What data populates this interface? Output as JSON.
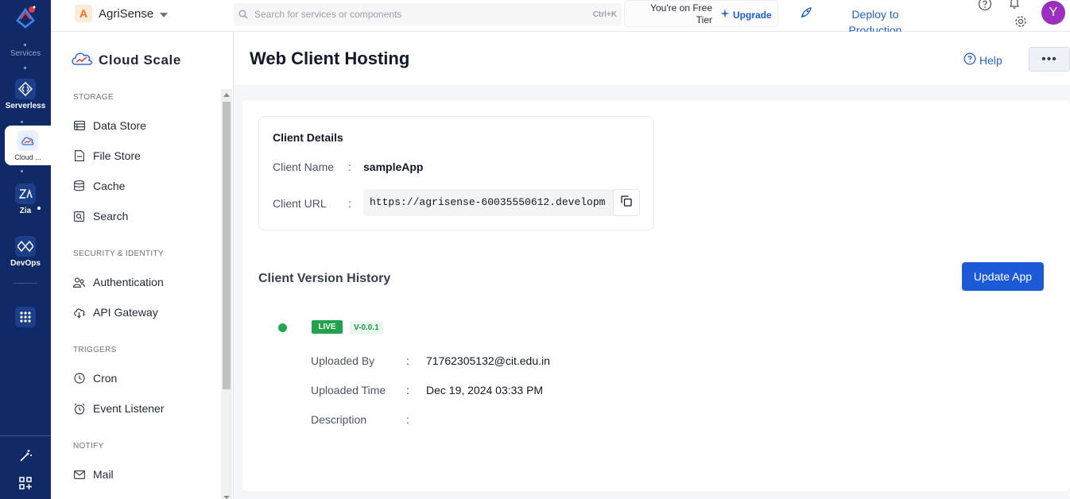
{
  "rail": {
    "services_label": "Services",
    "items": [
      {
        "label": "Serverless"
      },
      {
        "label": "Cloud ..."
      },
      {
        "label": "Zia"
      },
      {
        "label": "DevOps"
      }
    ]
  },
  "topbar": {
    "project_initial": "A",
    "project_name": "AgriSense",
    "search_placeholder": "Search for services or components",
    "search_shortcut": "Ctrl+K",
    "tier_line1": "You're on Free",
    "tier_line2": "Tier",
    "upgrade_label": "Upgrade",
    "deploy_line1": "Deploy to",
    "deploy_line2": "Production",
    "avatar_initial": "Y"
  },
  "sidebar": {
    "title": "Cloud Scale",
    "sections": [
      {
        "label": "STORAGE",
        "items": [
          {
            "label": "Data Store",
            "icon": "table-icon"
          },
          {
            "label": "File Store",
            "icon": "file-icon"
          },
          {
            "label": "Cache",
            "icon": "database-icon"
          },
          {
            "label": "Search",
            "icon": "search-icon"
          }
        ]
      },
      {
        "label": "SECURITY & IDENTITY",
        "items": [
          {
            "label": "Authentication",
            "icon": "users-icon"
          },
          {
            "label": "API Gateway",
            "icon": "cloud-gateway-icon"
          }
        ]
      },
      {
        "label": "TRIGGERS",
        "items": [
          {
            "label": "Cron",
            "icon": "clock-icon"
          },
          {
            "label": "Event Listener",
            "icon": "alarm-icon"
          }
        ]
      },
      {
        "label": "NOTIFY",
        "items": [
          {
            "label": "Mail",
            "icon": "mail-icon"
          }
        ]
      }
    ]
  },
  "main": {
    "title": "Web Client Hosting",
    "help_label": "Help",
    "more_label": "•••",
    "details": {
      "heading": "Client Details",
      "name_label": "Client Name",
      "name_value": "sampleApp",
      "url_label": "Client URL",
      "url_value": "https://agrisense-60035550612.developm",
      "colon": ":"
    },
    "history": {
      "title": "Client Version History",
      "update_label": "Update App",
      "status": "LIVE",
      "version": "V-0.0.1",
      "uploaded_by_label": "Uploaded By",
      "uploaded_by_value": "71762305132@cit.edu.in",
      "uploaded_time_label": "Uploaded Time",
      "uploaded_time_value": "Dec 19, 2024 03:33 PM",
      "description_label": "Description",
      "description_value": "",
      "colon": ":"
    }
  },
  "colors": {
    "rail_bg": "#0f2a66",
    "primary": "#1d5ad8",
    "live_green": "#23a24d",
    "avatar": "#9b2fc0"
  }
}
